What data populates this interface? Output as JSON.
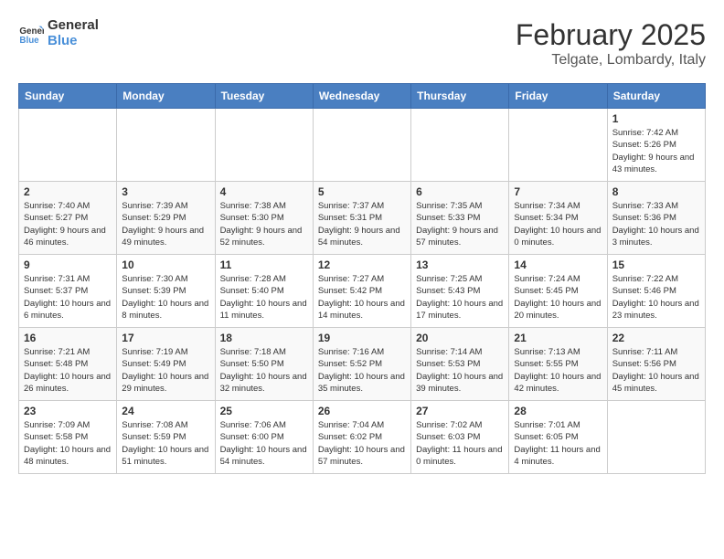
{
  "logo": {
    "line1": "General",
    "line2": "Blue"
  },
  "title": "February 2025",
  "location": "Telgate, Lombardy, Italy",
  "weekdays": [
    "Sunday",
    "Monday",
    "Tuesday",
    "Wednesday",
    "Thursday",
    "Friday",
    "Saturday"
  ],
  "weeks": [
    [
      {
        "day": "",
        "info": ""
      },
      {
        "day": "",
        "info": ""
      },
      {
        "day": "",
        "info": ""
      },
      {
        "day": "",
        "info": ""
      },
      {
        "day": "",
        "info": ""
      },
      {
        "day": "",
        "info": ""
      },
      {
        "day": "1",
        "info": "Sunrise: 7:42 AM\nSunset: 5:26 PM\nDaylight: 9 hours and 43 minutes."
      }
    ],
    [
      {
        "day": "2",
        "info": "Sunrise: 7:40 AM\nSunset: 5:27 PM\nDaylight: 9 hours and 46 minutes."
      },
      {
        "day": "3",
        "info": "Sunrise: 7:39 AM\nSunset: 5:29 PM\nDaylight: 9 hours and 49 minutes."
      },
      {
        "day": "4",
        "info": "Sunrise: 7:38 AM\nSunset: 5:30 PM\nDaylight: 9 hours and 52 minutes."
      },
      {
        "day": "5",
        "info": "Sunrise: 7:37 AM\nSunset: 5:31 PM\nDaylight: 9 hours and 54 minutes."
      },
      {
        "day": "6",
        "info": "Sunrise: 7:35 AM\nSunset: 5:33 PM\nDaylight: 9 hours and 57 minutes."
      },
      {
        "day": "7",
        "info": "Sunrise: 7:34 AM\nSunset: 5:34 PM\nDaylight: 10 hours and 0 minutes."
      },
      {
        "day": "8",
        "info": "Sunrise: 7:33 AM\nSunset: 5:36 PM\nDaylight: 10 hours and 3 minutes."
      }
    ],
    [
      {
        "day": "9",
        "info": "Sunrise: 7:31 AM\nSunset: 5:37 PM\nDaylight: 10 hours and 6 minutes."
      },
      {
        "day": "10",
        "info": "Sunrise: 7:30 AM\nSunset: 5:39 PM\nDaylight: 10 hours and 8 minutes."
      },
      {
        "day": "11",
        "info": "Sunrise: 7:28 AM\nSunset: 5:40 PM\nDaylight: 10 hours and 11 minutes."
      },
      {
        "day": "12",
        "info": "Sunrise: 7:27 AM\nSunset: 5:42 PM\nDaylight: 10 hours and 14 minutes."
      },
      {
        "day": "13",
        "info": "Sunrise: 7:25 AM\nSunset: 5:43 PM\nDaylight: 10 hours and 17 minutes."
      },
      {
        "day": "14",
        "info": "Sunrise: 7:24 AM\nSunset: 5:45 PM\nDaylight: 10 hours and 20 minutes."
      },
      {
        "day": "15",
        "info": "Sunrise: 7:22 AM\nSunset: 5:46 PM\nDaylight: 10 hours and 23 minutes."
      }
    ],
    [
      {
        "day": "16",
        "info": "Sunrise: 7:21 AM\nSunset: 5:48 PM\nDaylight: 10 hours and 26 minutes."
      },
      {
        "day": "17",
        "info": "Sunrise: 7:19 AM\nSunset: 5:49 PM\nDaylight: 10 hours and 29 minutes."
      },
      {
        "day": "18",
        "info": "Sunrise: 7:18 AM\nSunset: 5:50 PM\nDaylight: 10 hours and 32 minutes."
      },
      {
        "day": "19",
        "info": "Sunrise: 7:16 AM\nSunset: 5:52 PM\nDaylight: 10 hours and 35 minutes."
      },
      {
        "day": "20",
        "info": "Sunrise: 7:14 AM\nSunset: 5:53 PM\nDaylight: 10 hours and 39 minutes."
      },
      {
        "day": "21",
        "info": "Sunrise: 7:13 AM\nSunset: 5:55 PM\nDaylight: 10 hours and 42 minutes."
      },
      {
        "day": "22",
        "info": "Sunrise: 7:11 AM\nSunset: 5:56 PM\nDaylight: 10 hours and 45 minutes."
      }
    ],
    [
      {
        "day": "23",
        "info": "Sunrise: 7:09 AM\nSunset: 5:58 PM\nDaylight: 10 hours and 48 minutes."
      },
      {
        "day": "24",
        "info": "Sunrise: 7:08 AM\nSunset: 5:59 PM\nDaylight: 10 hours and 51 minutes."
      },
      {
        "day": "25",
        "info": "Sunrise: 7:06 AM\nSunset: 6:00 PM\nDaylight: 10 hours and 54 minutes."
      },
      {
        "day": "26",
        "info": "Sunrise: 7:04 AM\nSunset: 6:02 PM\nDaylight: 10 hours and 57 minutes."
      },
      {
        "day": "27",
        "info": "Sunrise: 7:02 AM\nSunset: 6:03 PM\nDaylight: 11 hours and 0 minutes."
      },
      {
        "day": "28",
        "info": "Sunrise: 7:01 AM\nSunset: 6:05 PM\nDaylight: 11 hours and 4 minutes."
      },
      {
        "day": "",
        "info": ""
      }
    ]
  ]
}
